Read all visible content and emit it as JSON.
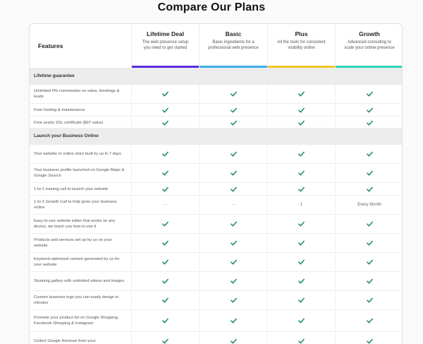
{
  "page_title": "Compare Our Plans",
  "features_header": "Features",
  "plans": [
    {
      "name": "Lifetime Deal",
      "desc": "The web presence setup you need to get started",
      "color": "#5b2be0"
    },
    {
      "name": "Basic",
      "desc": "Basic ingredients for a professional web presence",
      "color": "#3ab0e8"
    },
    {
      "name": "Plus",
      "desc": "All the tools for consistent visibility online",
      "color": "#f2c623"
    },
    {
      "name": "Growth",
      "desc": "Advanced consulting to scale your online presence",
      "color": "#2ed3b7"
    }
  ],
  "check_color": "#27925a",
  "sections": [
    {
      "title": "Lifetime guarantee",
      "rows": [
        {
          "label": "Unlimited 0% commission on sales, bookings & leads",
          "values": [
            "check",
            "check",
            "check",
            "check"
          ]
        },
        {
          "label": "Free hosting & maintenance",
          "values": [
            "check",
            "check",
            "check",
            "check"
          ]
        },
        {
          "label": "Free yearly SSL certificate ($97 value)",
          "values": [
            "check",
            "check",
            "check",
            "check"
          ]
        }
      ]
    },
    {
      "title": "Launch your Business Online",
      "rows": [
        {
          "label": "Your website or online store built by us in 7 days",
          "values": [
            "check",
            "check",
            "check",
            "check"
          ]
        },
        {
          "label": "Your business profile launched on Google Maps & Google Search",
          "values": [
            "check",
            "check",
            "check",
            "check"
          ]
        },
        {
          "label": "1-to-1 training call to launch your website",
          "values": [
            "check",
            "check",
            "check",
            "check"
          ]
        },
        {
          "label": "1-to-1 Growth Call to help grow your business online",
          "values": [
            "—",
            "—",
            "1",
            "Every Month"
          ]
        },
        {
          "label": "Easy-to-use website editor that works on any device, we teach you how to use it",
          "values": [
            "check",
            "check",
            "check",
            "check"
          ]
        },
        {
          "label": "Products and services set up by us on your website",
          "values": [
            "check",
            "check",
            "check",
            "check"
          ]
        },
        {
          "label": "Keyword-optimized content generated by us for your website",
          "values": [
            "check",
            "check",
            "check",
            "check"
          ]
        },
        {
          "label": "Stunning gallery with unlimited videos and images",
          "values": [
            "check",
            "check",
            "check",
            "check"
          ]
        },
        {
          "label": "Custom business logo you can easily design in minutes",
          "values": [
            "check",
            "check",
            "check",
            "check"
          ]
        },
        {
          "label": "Promote your product list on Google Shopping, Facebook Shopping & Instagram",
          "values": [
            "check",
            "check",
            "check",
            "check"
          ]
        },
        {
          "label": "Collect Google Reviews from your",
          "values": [
            "check",
            "check",
            "check",
            "check"
          ]
        }
      ]
    }
  ]
}
